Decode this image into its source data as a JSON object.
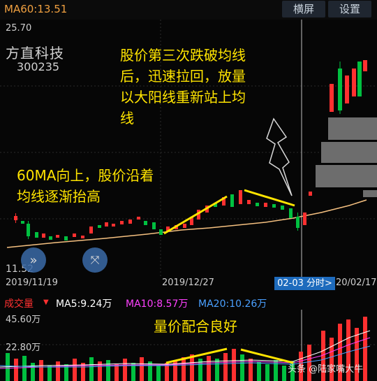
{
  "header": {
    "ma60": "MA60:13.51",
    "btn_landscape": "横屏",
    "btn_settings": "设置"
  },
  "stock": {
    "name": "方直科技",
    "code": "300235"
  },
  "price_axis": {
    "high": "25.70",
    "low": "11.52"
  },
  "annotations": {
    "top": [
      "股价第三次跌破均线",
      "后，迅速拉回，放量",
      "以大阳线重新站上均",
      "线"
    ],
    "left": [
      "60MA向上，股价沿着",
      "均线逐渐抬高"
    ],
    "volume": "量价配合良好"
  },
  "dates": {
    "start": "2019/11/19",
    "mid": "2019/12/27",
    "end": "20/02/17",
    "badge": "02-03 分时>"
  },
  "volume_header": {
    "label": "成交量",
    "ma5": "MA5:9.24万",
    "ma10": "MA10:8.57万",
    "ma20": "MA20:10.26万"
  },
  "volume_axis": {
    "high": "45.60万",
    "mid": "22.80万"
  },
  "watermark": "头条 @陆家嘴大牛",
  "colors": {
    "up": "#ff3030",
    "down": "#00c040",
    "ma60": "#f5c080",
    "annotation": "#ffe400",
    "ma5": "#ffffff",
    "ma10": "#ff40ff",
    "ma20": "#4aa0ff"
  }
}
